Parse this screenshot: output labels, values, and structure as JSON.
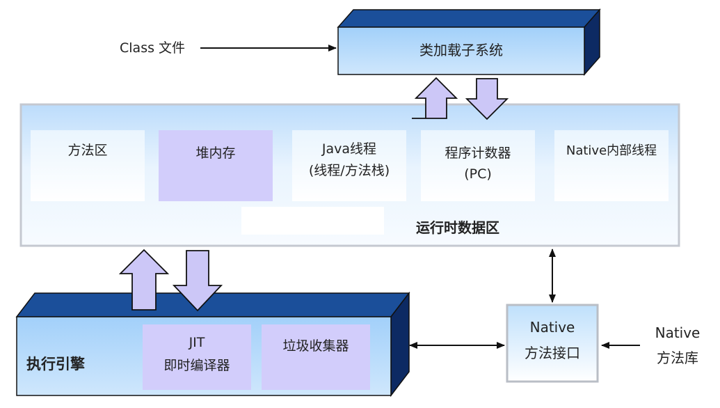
{
  "diagram": {
    "input_label": "Class 文件",
    "class_loader": {
      "label": "类加载子系统"
    },
    "runtime_area": {
      "title": "运行时数据区",
      "cells": [
        {
          "id": "method-area",
          "label": "方法区"
        },
        {
          "id": "heap",
          "label": "堆内存"
        },
        {
          "id": "java-thread",
          "label": "Java线程",
          "sub": "(线程/方法栈)"
        },
        {
          "id": "pc-register",
          "label": "程序计数器",
          "sub": "(PC)"
        },
        {
          "id": "native-thread",
          "label": "Native内部线程"
        }
      ]
    },
    "execution_engine": {
      "title": "执行引擎",
      "jit": {
        "label": "JIT",
        "sub": "即时编译器"
      },
      "gc": {
        "label": "垃圾收集器"
      }
    },
    "native_interface": {
      "line1": "Native",
      "line2": "方法接口"
    },
    "native_library": {
      "line1": "Native",
      "line2": "方法库"
    },
    "colors": {
      "box_blue": "#a8d4fa",
      "box_side": "#0d2a63",
      "box_top": "#1b4f9a",
      "panel_border": "#c4c8d0",
      "lavender": "#d2cdfb",
      "arrow_fill": "#ccc7f7",
      "arrow_stroke": "#111111"
    }
  }
}
